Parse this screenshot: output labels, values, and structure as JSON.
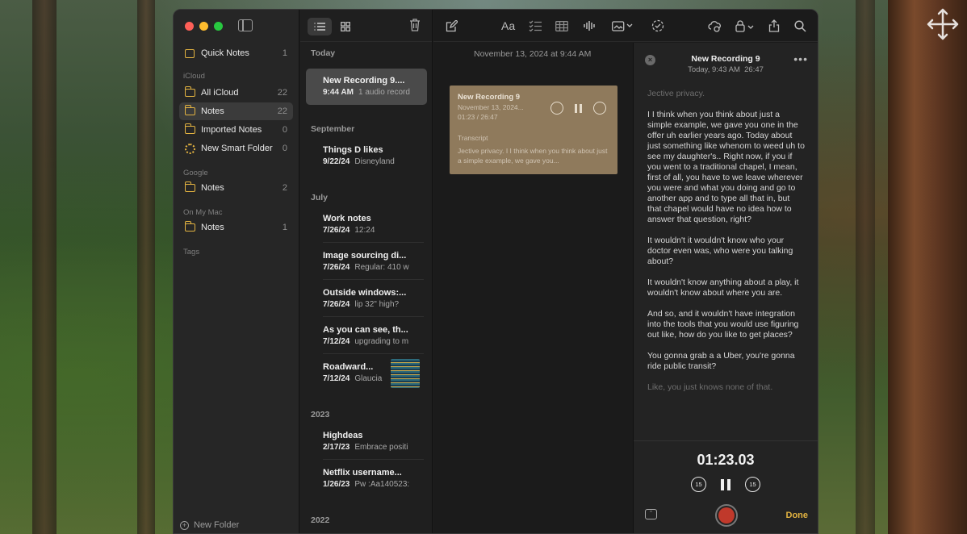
{
  "sidebar": {
    "quick_notes": {
      "label": "Quick Notes",
      "count": "1"
    },
    "icloud_header": "iCloud",
    "icloud_items": [
      {
        "label": "All iCloud",
        "count": "22"
      },
      {
        "label": "Notes",
        "count": "22"
      },
      {
        "label": "Imported Notes",
        "count": "0"
      },
      {
        "label": "New Smart Folder",
        "count": "0"
      }
    ],
    "google_header": "Google",
    "google_notes": {
      "label": "Notes",
      "count": "2"
    },
    "mac_header": "On My Mac",
    "mac_notes": {
      "label": "Notes",
      "count": "1"
    },
    "tags_header": "Tags",
    "new_folder": "New Folder"
  },
  "list": {
    "sections": {
      "today": "Today",
      "september": "September",
      "july": "July",
      "y2023": "2023",
      "y2022": "2022"
    },
    "notes": [
      {
        "title": "New Recording 9....",
        "time": "9:44 AM",
        "preview": "1 audio record"
      },
      {
        "title": "Things D likes",
        "time": "9/22/24",
        "preview": "Disneyland"
      },
      {
        "title": "Work notes",
        "time": "7/26/24",
        "preview": "12:24"
      },
      {
        "title": "Image sourcing di...",
        "time": "7/26/24",
        "preview": "Regular: 410 w"
      },
      {
        "title": "Outside windows:...",
        "time": "7/26/24",
        "preview": "lip 32\" high?"
      },
      {
        "title": "As you can see, th...",
        "time": "7/12/24",
        "preview": "upgrading to m"
      },
      {
        "title": "Roadward...",
        "time": "7/12/24",
        "preview": "Glaucia"
      },
      {
        "title": "Highdeas",
        "time": "2/17/23",
        "preview": "Embrace positi"
      },
      {
        "title": "Netflix username...",
        "time": "1/26/23",
        "preview": "Pw :Aa140523:"
      }
    ]
  },
  "editor": {
    "date": "November 13, 2024 at 9:44 AM",
    "card": {
      "title": "New Recording 9",
      "date": "November 13, 2024...",
      "progress": "01:23 / 26:47",
      "transcript_header": "Transcript",
      "transcript_preview": "Jective privacy. I I think when you think about just a simple example, we gave you..."
    },
    "toolbar": {
      "format": "Aa"
    }
  },
  "panel": {
    "title": "New Recording 9",
    "date": "Today, 9:43 AM",
    "duration": "26:47",
    "paragraphs": {
      "p0": "Jective privacy.",
      "p1": "I I think when you think about just a simple example, we gave you one in the offer uh earlier years ago. Today about just something like whenom to weed uh to see my daughter's.. Right now, if you if you went to a traditional chapel, I mean, first of all, you have to we leave wherever you were and what you doing and go to another app and to type all that in, but that chapel would have no idea how to answer that question, right?",
      "p2": "It wouldn't it wouldn't know who your doctor even was, who were you talking about?",
      "p3": "It wouldn't know anything about a play, it wouldn't know about where you are.",
      "p4": "And so, and it wouldn't have integration into the tools that you would use figuring out like, how do you like to get places?",
      "p5": "You gonna grab a a Uber, you're gonna ride public transit?",
      "p6": "Like, you just knows none of that."
    },
    "time": "01:23.03",
    "skip_back": "15",
    "skip_fwd": "15",
    "done": "Done"
  }
}
